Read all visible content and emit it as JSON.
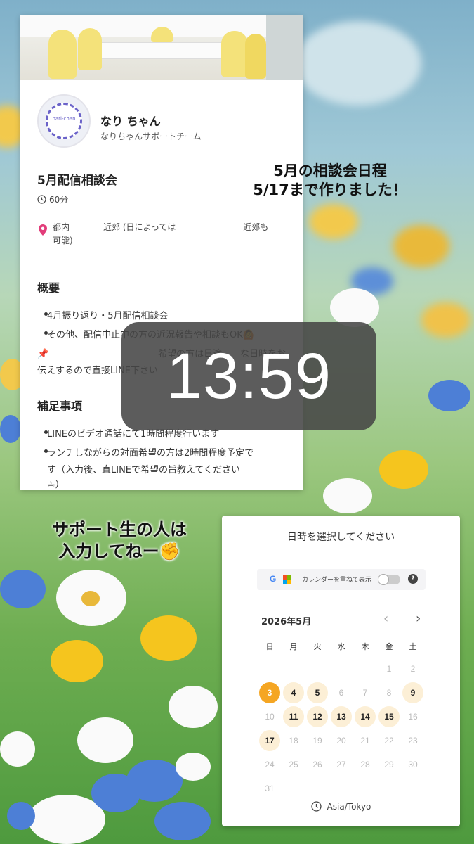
{
  "profile": {
    "name": "なり ちゃん",
    "team": "なりちゃんサポートチーム",
    "avatar_text": "nari-chan"
  },
  "event": {
    "title": "5月配信相談会",
    "duration": "60分",
    "location_line1": "都内　　　　近郊 (日によっては　　　　　　　　近郊も",
    "location_line2": "可能)"
  },
  "overview": {
    "heading": "概要",
    "items": [
      "4月振り返り・5月配信相談会",
      "その他、配信中止中の方の近況報告や相談もOK🙆",
      "📌　　　　　　　　　　　　希望の方は日途　　な日時をお",
      "伝えするので直接LINE下さい"
    ]
  },
  "supplement": {
    "heading": "補足事項",
    "items": [
      "LINEのビデオ通話にて1時間程度行います",
      "ランチしながらの対面希望の方は2時間程度予定で",
      "す（入力後、直LINEで希望の旨教えてください",
      "☕）"
    ]
  },
  "clock": {
    "time": "13:59"
  },
  "overlay": {
    "line1": "5月の相談会日程",
    "line2": "5/17まで作りました！",
    "sub1": "サポート生の人は",
    "sub2": "入力してねー✊"
  },
  "calendar": {
    "header": "日時を選択してください",
    "overlay_label": "カレンダーを重ねて表示",
    "month": "2026年5月",
    "weekdays": [
      "日",
      "月",
      "火",
      "水",
      "木",
      "金",
      "土"
    ],
    "timezone": "Asia/Tokyo",
    "accent": "#f5a623",
    "available_bg": "#fcefd6",
    "weeks": [
      [
        null,
        null,
        null,
        null,
        null,
        {
          "d": "1",
          "s": "off"
        },
        {
          "d": "2",
          "s": "off"
        }
      ],
      [
        {
          "d": "3",
          "s": "selected"
        },
        {
          "d": "4",
          "s": "avail"
        },
        {
          "d": "5",
          "s": "avail"
        },
        {
          "d": "6",
          "s": "off"
        },
        {
          "d": "7",
          "s": "off"
        },
        {
          "d": "8",
          "s": "off"
        },
        {
          "d": "9",
          "s": "avail"
        }
      ],
      [
        {
          "d": "10",
          "s": "off"
        },
        {
          "d": "11",
          "s": "avail"
        },
        {
          "d": "12",
          "s": "avail"
        },
        {
          "d": "13",
          "s": "avail"
        },
        {
          "d": "14",
          "s": "avail"
        },
        {
          "d": "15",
          "s": "avail"
        },
        {
          "d": "16",
          "s": "off"
        }
      ],
      [
        {
          "d": "17",
          "s": "avail"
        },
        {
          "d": "18",
          "s": "off"
        },
        {
          "d": "19",
          "s": "off"
        },
        {
          "d": "20",
          "s": "off"
        },
        {
          "d": "21",
          "s": "off"
        },
        {
          "d": "22",
          "s": "off"
        },
        {
          "d": "23",
          "s": "off"
        }
      ],
      [
        {
          "d": "24",
          "s": "off"
        },
        {
          "d": "25",
          "s": "off"
        },
        {
          "d": "26",
          "s": "off"
        },
        {
          "d": "27",
          "s": "off"
        },
        {
          "d": "28",
          "s": "off"
        },
        {
          "d": "29",
          "s": "off"
        },
        {
          "d": "30",
          "s": "off"
        }
      ],
      [
        {
          "d": "31",
          "s": "off"
        },
        null,
        null,
        null,
        null,
        null,
        null
      ]
    ]
  }
}
